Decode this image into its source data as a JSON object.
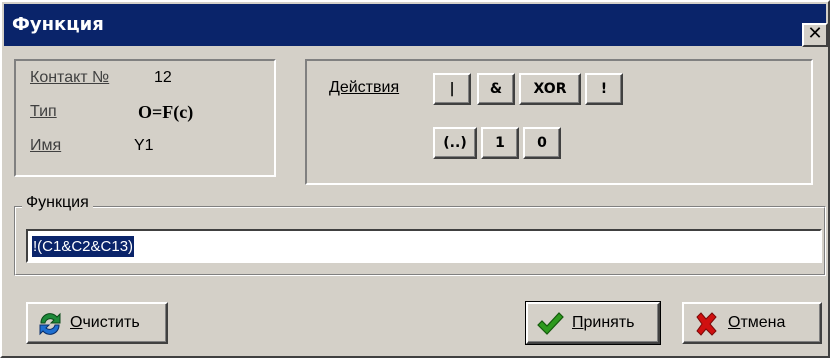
{
  "window": {
    "title": "Функция",
    "close_symbol": "✕"
  },
  "contact": {
    "number_label": "Контакт №",
    "number_value": "12",
    "type_label": "Тип",
    "type_value": "O=F(c)",
    "name_label": "Имя",
    "name_value": "Y1"
  },
  "actions": {
    "label": "Действия",
    "buttons": [
      {
        "label": "|",
        "name": "or-operator-button"
      },
      {
        "label": "&",
        "name": "and-operator-button"
      },
      {
        "label": "XOR",
        "name": "xor-operator-button"
      },
      {
        "label": "!",
        "name": "not-operator-button"
      },
      {
        "label": "(..)",
        "name": "parentheses-button"
      },
      {
        "label": "1",
        "name": "constant-one-button"
      },
      {
        "label": "0",
        "name": "constant-zero-button"
      }
    ]
  },
  "function": {
    "group_label": "Функция",
    "value": "!(C1&C2&C13)"
  },
  "footer": {
    "clear": {
      "first": "О",
      "rest": "чистить",
      "icon": "refresh-icon"
    },
    "accept": {
      "first": "П",
      "rest": "ринять",
      "icon": "checkmark-icon"
    },
    "cancel": {
      "first": "О",
      "rest": "тмена",
      "icon": "red-x-icon"
    }
  },
  "colors": {
    "titlebar": "#0a246a",
    "face": "#d4d0c8",
    "selection": "#0a246a",
    "accept_icon": "#2e9a1e",
    "clear_icon": "#1e8a3a",
    "cancel_icon": "#d01010"
  }
}
